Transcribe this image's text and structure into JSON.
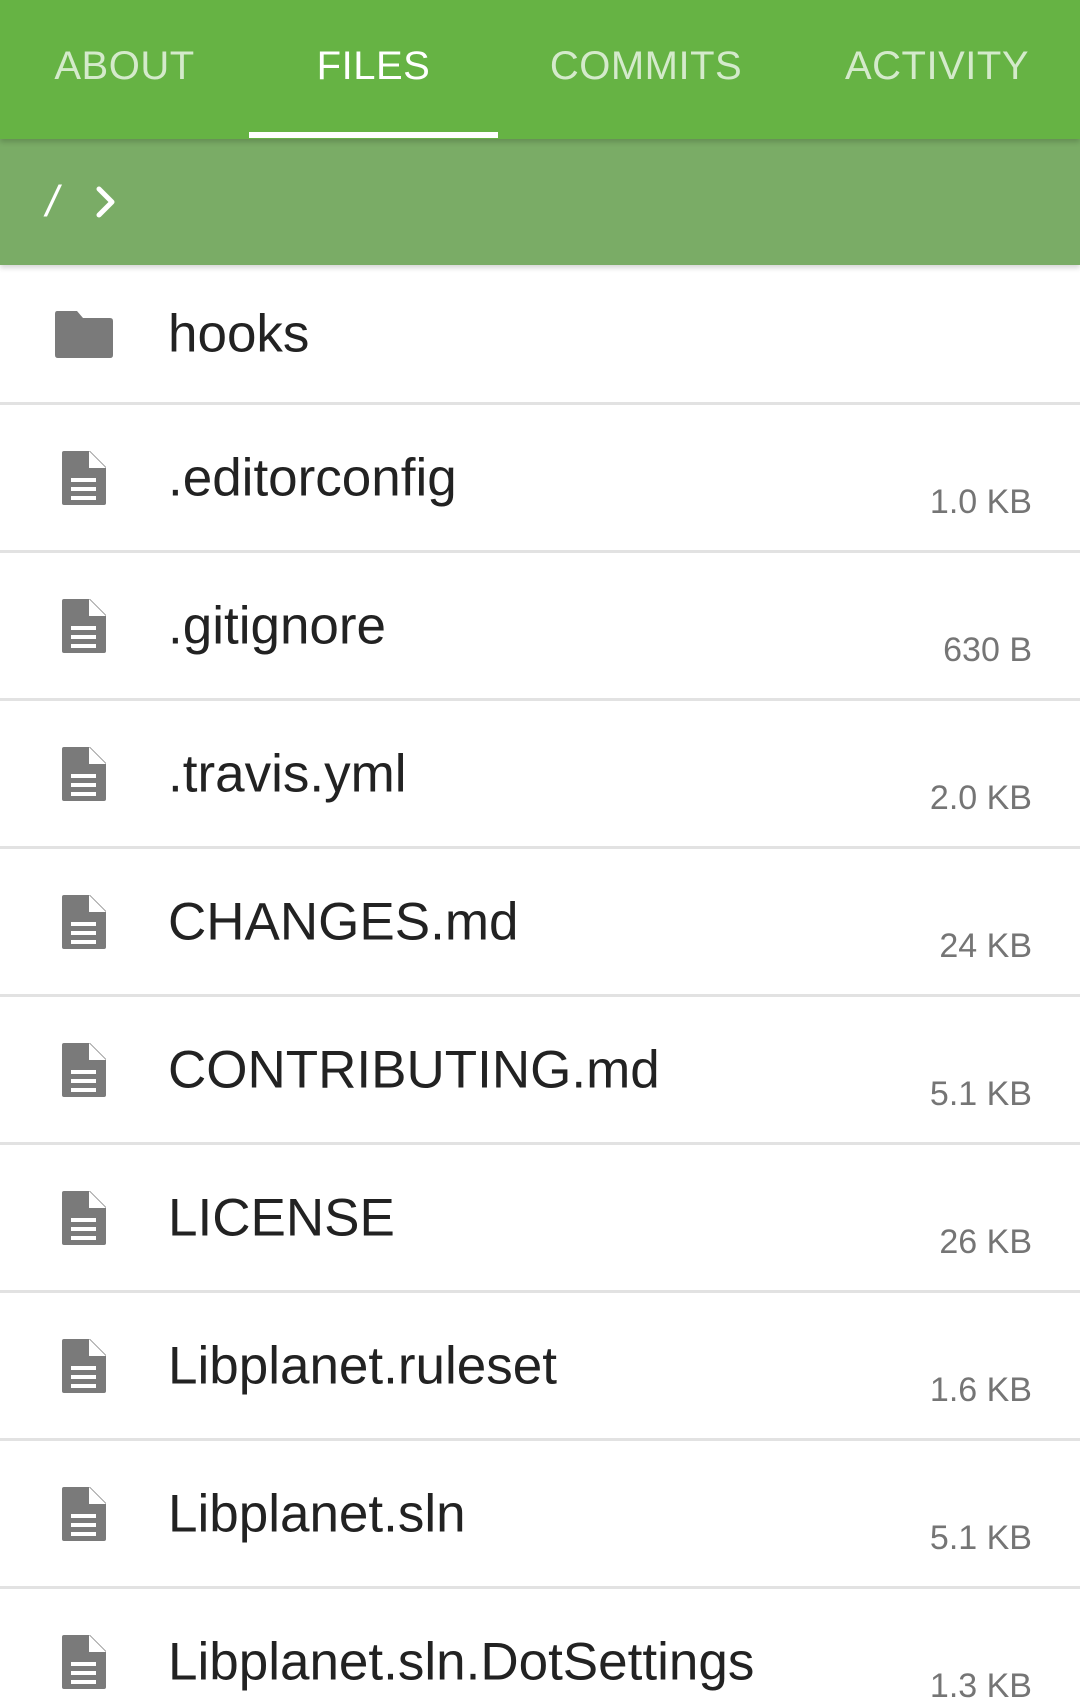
{
  "tabs": [
    {
      "label": "ABOUT"
    },
    {
      "label": "FILES"
    },
    {
      "label": "COMMITS"
    },
    {
      "label": "ACTIVITY"
    }
  ],
  "active_tab": "FILES",
  "breadcrumb": {
    "root": "/"
  },
  "files": [
    {
      "name": "hooks",
      "type": "folder",
      "icon": "folder-icon",
      "size": ""
    },
    {
      "name": ".editorconfig",
      "type": "file",
      "icon": "file-document-icon",
      "size": "1.0 KB"
    },
    {
      "name": ".gitignore",
      "type": "file",
      "icon": "file-document-icon",
      "size": "630 B"
    },
    {
      "name": ".travis.yml",
      "type": "file",
      "icon": "file-document-icon",
      "size": "2.0 KB"
    },
    {
      "name": "CHANGES.md",
      "type": "file",
      "icon": "file-document-icon",
      "size": "24 KB"
    },
    {
      "name": "CONTRIBUTING.md",
      "type": "file",
      "icon": "file-document-icon",
      "size": "5.1 KB"
    },
    {
      "name": "LICENSE",
      "type": "file",
      "icon": "file-document-icon",
      "size": "26 KB"
    },
    {
      "name": "Libplanet.ruleset",
      "type": "file",
      "icon": "file-document-icon",
      "size": "1.6 KB"
    },
    {
      "name": "Libplanet.sln",
      "type": "file",
      "icon": "file-document-icon",
      "size": "5.1 KB"
    },
    {
      "name": "Libplanet.sln.DotSettings",
      "type": "file",
      "icon": "file-document-icon",
      "size": "1.3 KB"
    }
  ],
  "colors": {
    "tab_bar": "#66b344",
    "breadcrumb_bar": "#7aac66",
    "icon": "#7a7a7a",
    "divider": "#e2e2e2"
  }
}
